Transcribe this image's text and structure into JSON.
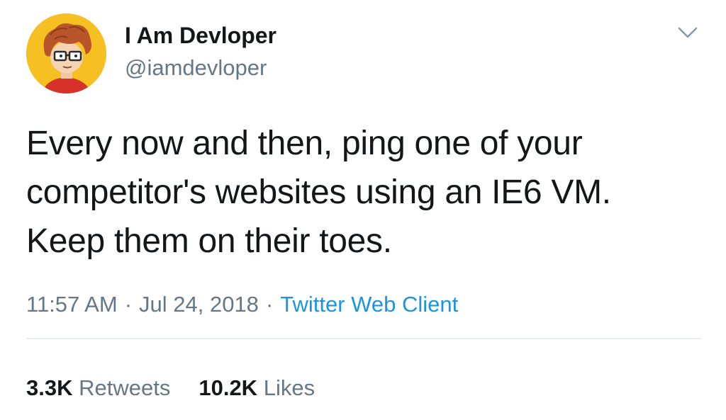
{
  "tweet": {
    "author": {
      "name": "I Am Devloper",
      "handle": "@iamdevloper",
      "avatar_icon": "cartoon-developer-with-glasses",
      "avatar_bg": "#f6bf22"
    },
    "menu_icon": "chevron-down-icon",
    "text": "Every now and then, ping one of your\ncompetitor's websites using an IE6 VM.\nKeep them on their toes.",
    "time": "11:57 AM",
    "separator": "·",
    "date": "Jul 24, 2018",
    "source": "Twitter Web Client",
    "stats": {
      "retweets_count": "3.3K",
      "retweets_label": "Retweets",
      "likes_count": "10.2K",
      "likes_label": "Likes"
    },
    "colors": {
      "text": "#14171a",
      "secondary": "#657786",
      "link": "#1b95e0",
      "divider": "#e6ecf0"
    }
  }
}
